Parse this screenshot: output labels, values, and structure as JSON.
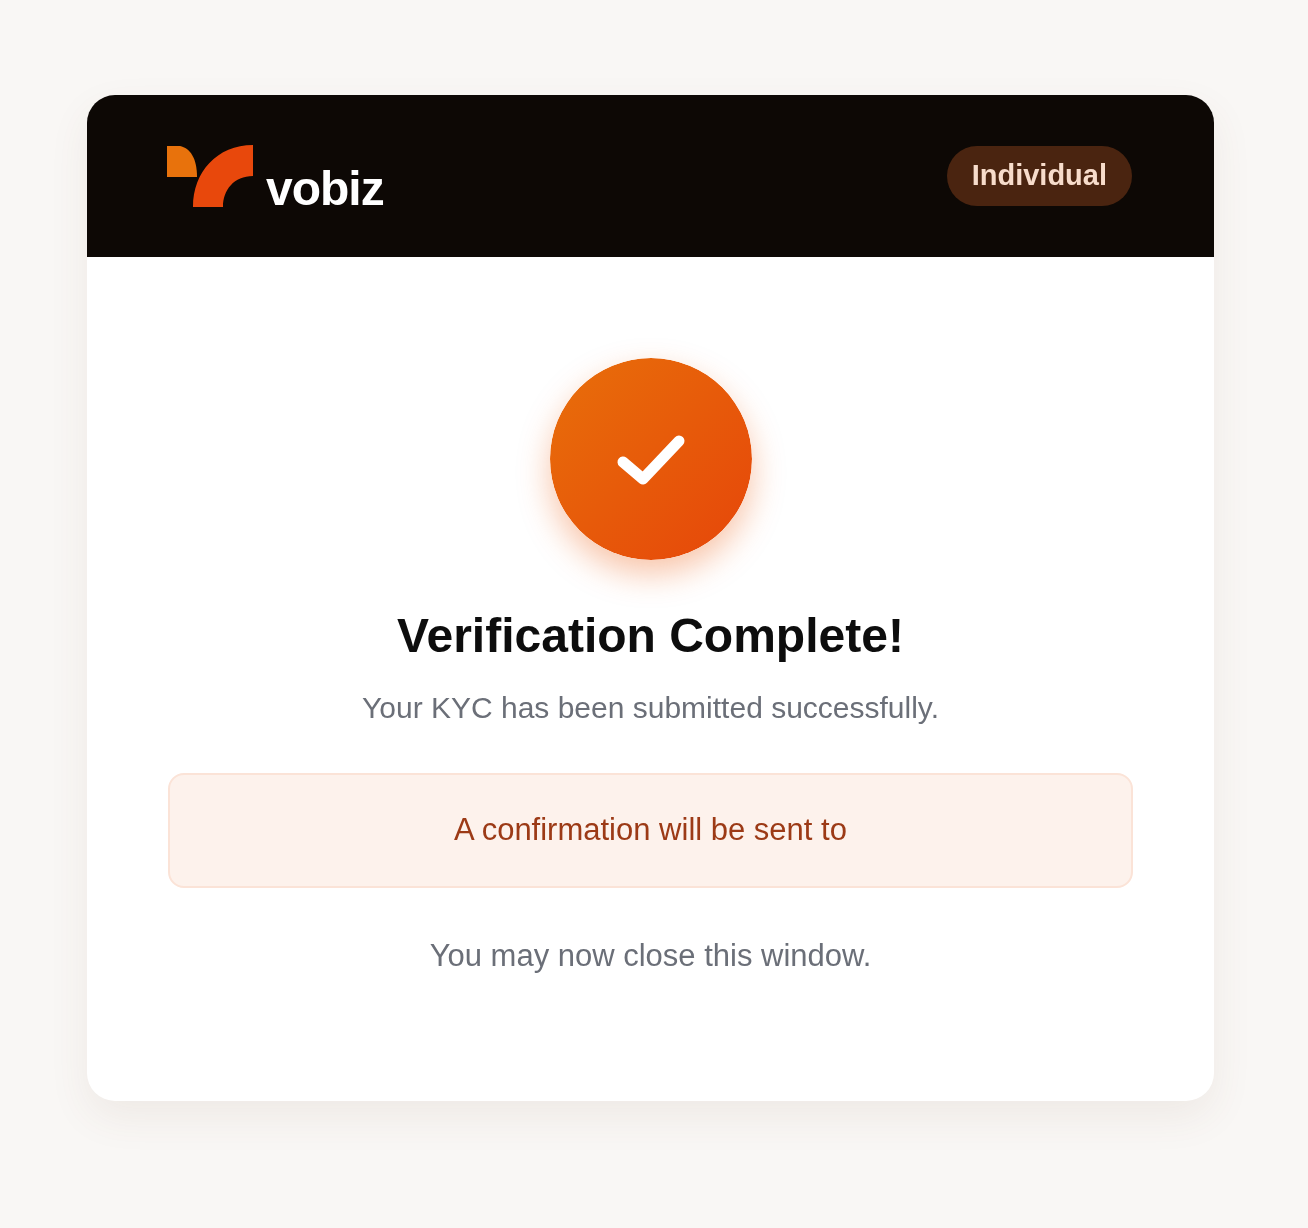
{
  "header": {
    "logo_text": "vobiz",
    "badge": "Individual"
  },
  "status": {
    "kind": "success",
    "title": "Verification Complete!",
    "subtitle": "Your KYC has been submitted successfully."
  },
  "notice": {
    "text": "A confirmation will be sent to"
  },
  "footer_note": "You may now close this window."
}
